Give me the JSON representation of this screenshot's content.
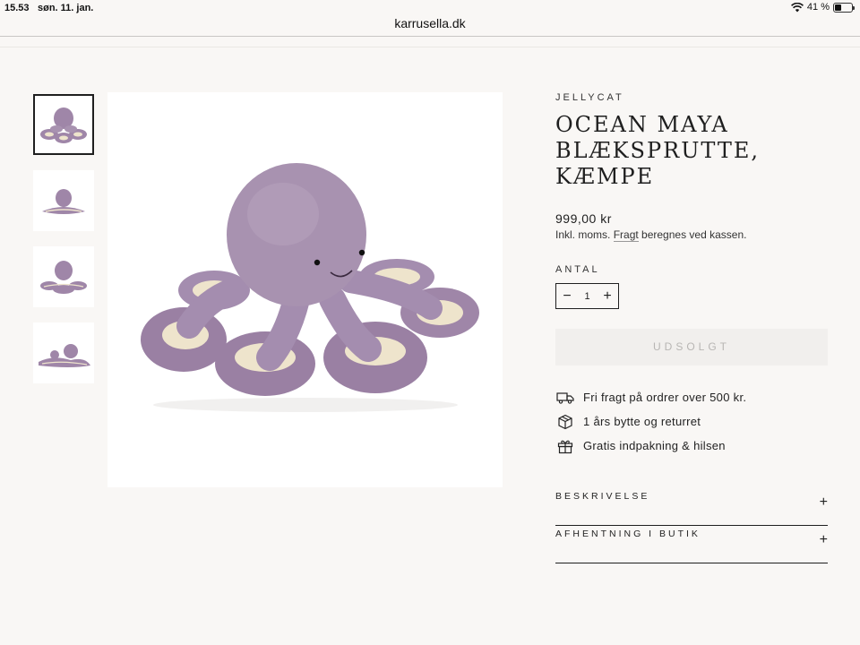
{
  "status_bar": {
    "time": "15.53",
    "date": "søn. 11. jan.",
    "battery_text": "41 %",
    "battery_level": 0.41
  },
  "browser": {
    "url": "karrusella.dk"
  },
  "gallery": {
    "thumbnails": [
      "octopus-front-view",
      "octopus-side-view",
      "octopus-back-view",
      "octopus-size-comparison"
    ],
    "main_image": "octopus-plush-main"
  },
  "product": {
    "vendor": "JELLYCAT",
    "title_lines": [
      "OCEAN MAYA",
      "BLÆKSPRUTTE,",
      "KÆMPE"
    ],
    "price": "999,00 kr",
    "tax_prefix": "Inkl. moms. ",
    "tax_link": "Fragt",
    "tax_suffix": " beregnes ved kassen.",
    "quantity_label": "ANTAL",
    "quantity_minus": "−",
    "quantity_value": "1",
    "quantity_plus": "+",
    "soldout_label": "UDSOLGT",
    "perks": [
      {
        "icon": "truck-icon",
        "text": "Fri fragt på ordrer over 500 kr."
      },
      {
        "icon": "box-icon",
        "text": "1 års bytte og returret"
      },
      {
        "icon": "gift-icon",
        "text": "Gratis indpakning & hilsen"
      }
    ],
    "accordion": [
      {
        "label": "BESKRIVELSE",
        "toggle": "+"
      },
      {
        "label": "AFHENTNING I BUTIK",
        "toggle": "+"
      }
    ]
  },
  "colors": {
    "background": "#f9f7f5",
    "plush": "#9f86a8",
    "plush_tentacle_inner": "#eee4cc",
    "text": "#1f1f1f",
    "soldout_bg": "#f1efed"
  }
}
